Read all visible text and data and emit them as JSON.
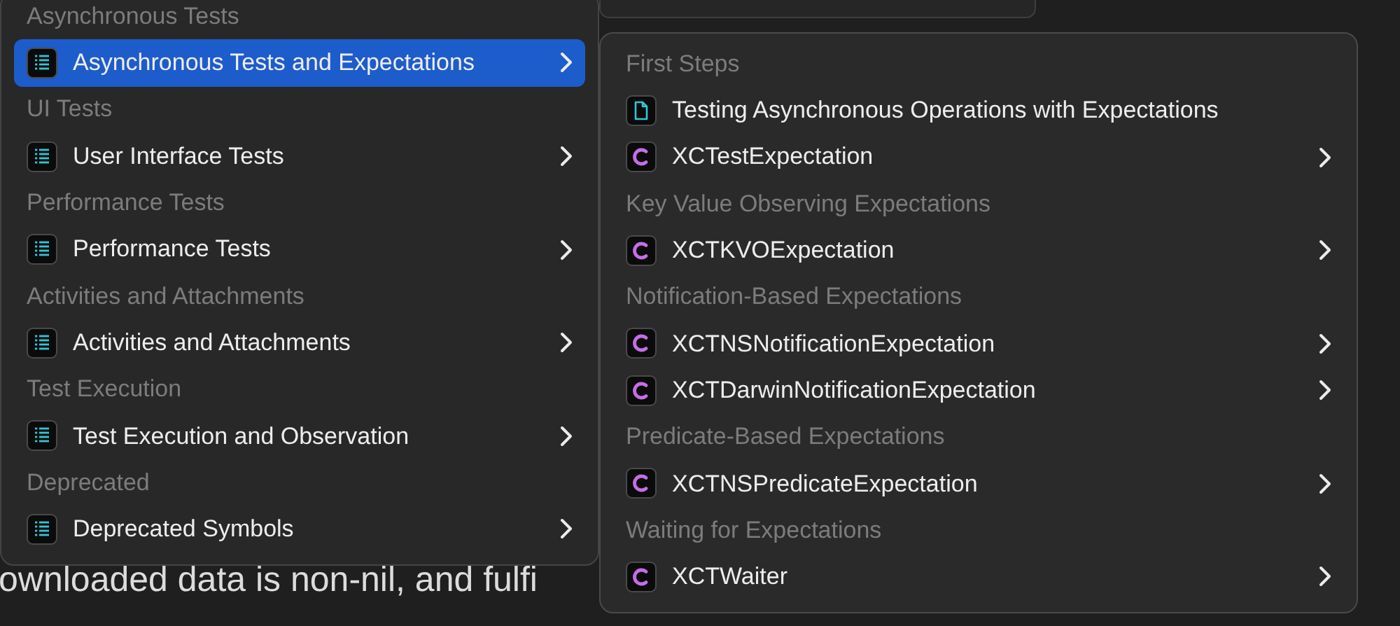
{
  "background_text": "ownloaded data is non-nil, and fulfi",
  "main_menu": {
    "sections": [
      {
        "header": "Asynchronous Tests",
        "items": [
          {
            "label": "Asynchronous Tests and Expectations",
            "kind": "list",
            "selected": true,
            "has_submenu": true
          }
        ]
      },
      {
        "header": "UI Tests",
        "items": [
          {
            "label": "User Interface Tests",
            "kind": "list",
            "selected": false,
            "has_submenu": true
          }
        ]
      },
      {
        "header": "Performance Tests",
        "items": [
          {
            "label": "Performance Tests",
            "kind": "list",
            "selected": false,
            "has_submenu": true
          }
        ]
      },
      {
        "header": "Activities and Attachments",
        "items": [
          {
            "label": "Activities and Attachments",
            "kind": "list",
            "selected": false,
            "has_submenu": true
          }
        ]
      },
      {
        "header": "Test Execution",
        "items": [
          {
            "label": "Test Execution and Observation",
            "kind": "list",
            "selected": false,
            "has_submenu": true
          }
        ]
      },
      {
        "header": "Deprecated",
        "items": [
          {
            "label": "Deprecated Symbols",
            "kind": "list",
            "selected": false,
            "has_submenu": true
          }
        ]
      }
    ]
  },
  "submenu": {
    "sections": [
      {
        "header": "First Steps",
        "items": [
          {
            "label": "Testing Asynchronous Operations with Expectations",
            "kind": "article",
            "selected": false,
            "has_submenu": false
          },
          {
            "label": "XCTestExpectation",
            "kind": "class",
            "selected": false,
            "has_submenu": true
          }
        ]
      },
      {
        "header": "Key Value Observing Expectations",
        "items": [
          {
            "label": "XCTKVOExpectation",
            "kind": "class",
            "selected": false,
            "has_submenu": true
          }
        ]
      },
      {
        "header": "Notification-Based Expectations",
        "items": [
          {
            "label": "XCTNSNotificationExpectation",
            "kind": "class",
            "selected": false,
            "has_submenu": true
          },
          {
            "label": "XCTDarwinNotificationExpectation",
            "kind": "class",
            "selected": false,
            "has_submenu": true
          }
        ]
      },
      {
        "header": "Predicate-Based Expectations",
        "items": [
          {
            "label": "XCTNSPredicateExpectation",
            "kind": "class",
            "selected": false,
            "has_submenu": true
          }
        ]
      },
      {
        "header": "Waiting for Expectations",
        "items": [
          {
            "label": "XCTWaiter",
            "kind": "class",
            "selected": false,
            "has_submenu": true
          }
        ]
      }
    ]
  }
}
